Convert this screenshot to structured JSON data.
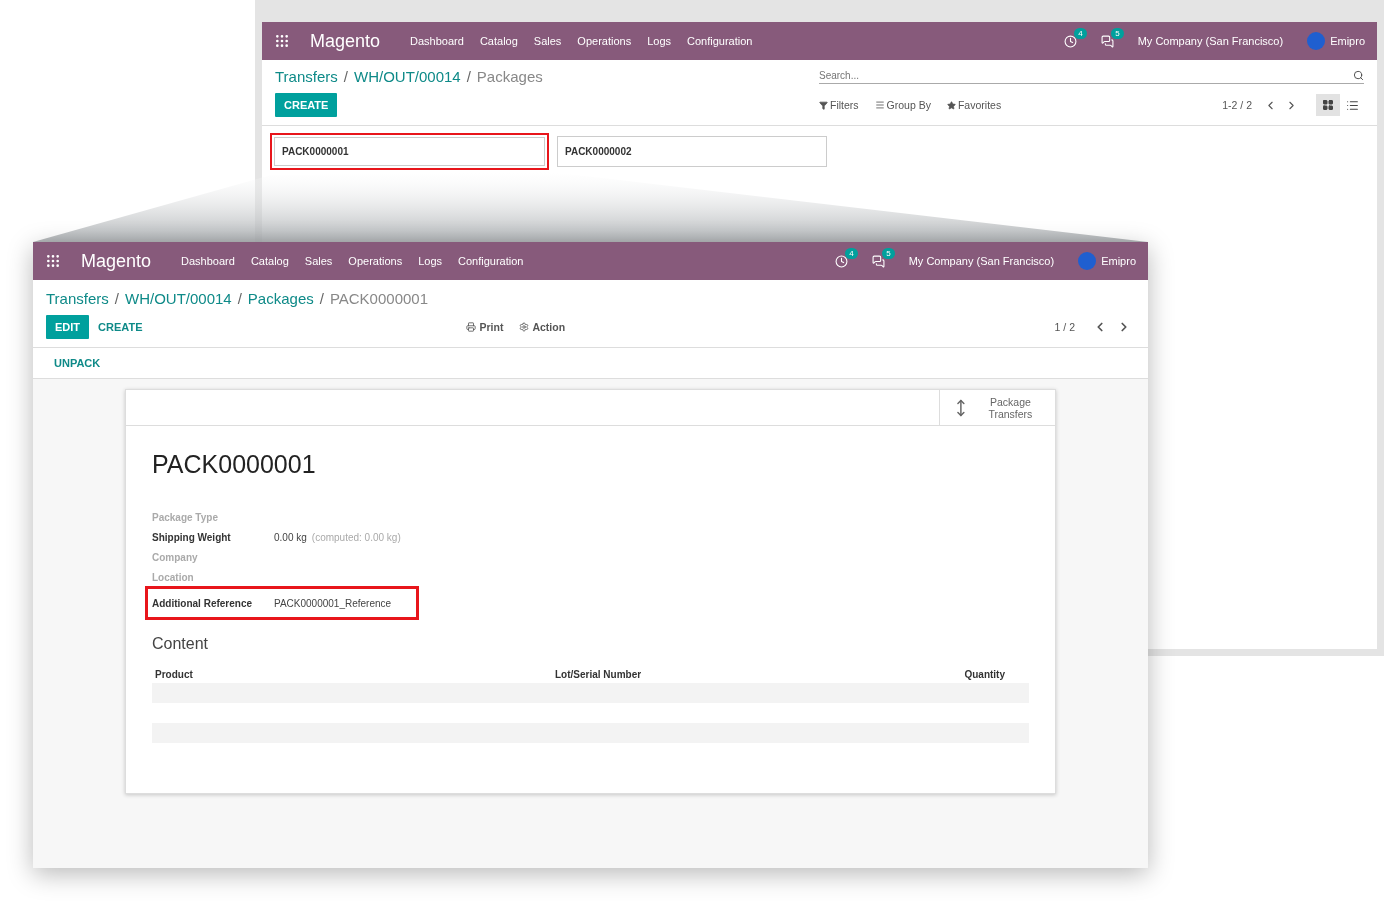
{
  "back_window": {
    "navbar": {
      "brand": "Magento",
      "menu": [
        "Dashboard",
        "Catalog",
        "Sales",
        "Operations",
        "Logs",
        "Configuration"
      ],
      "activity_count": "4",
      "message_count": "5",
      "company": "My Company (San Francisco)",
      "user": "Emipro"
    },
    "breadcrumbs": [
      {
        "label": "Transfers",
        "current": false
      },
      {
        "separator": "/",
        "label": "WH/OUT/00014",
        "current": false
      },
      {
        "separator": "/",
        "label": "Packages",
        "current": true
      }
    ],
    "create_button": "CREATE",
    "search": {
      "placeholder": "Search..."
    },
    "filters": [
      {
        "kind": "filter",
        "label": "Filters"
      },
      {
        "kind": "group",
        "label": "Group By"
      },
      {
        "kind": "favorite",
        "label": "Favorites"
      }
    ],
    "pager": "1-2 / 2",
    "views": [
      {
        "kind": "kanban",
        "selected": true
      },
      {
        "kind": "list",
        "selected": false
      }
    ],
    "cards": [
      {
        "name": "PACK0000001",
        "highlighted": true
      },
      {
        "name": "PACK0000002",
        "highlighted": false
      }
    ]
  },
  "front_window": {
    "navbar": {
      "brand": "Magento",
      "menu": [
        "Dashboard",
        "Catalog",
        "Sales",
        "Operations",
        "Logs",
        "Configuration"
      ],
      "activity_count": "4",
      "message_count": "5",
      "company": "My Company (San Francisco)",
      "user": "Emipro"
    },
    "breadcrumbs": [
      {
        "label": "Transfers",
        "current": false
      },
      {
        "separator": "/",
        "label": "WH/OUT/00014",
        "current": false
      },
      {
        "separator": "/",
        "label": "Packages",
        "current": false
      },
      {
        "separator": "/",
        "label": "PACK0000001",
        "current": true
      }
    ],
    "buttons": [
      {
        "label": "EDIT",
        "primary": true
      },
      {
        "label": "CREATE",
        "primary": false
      }
    ],
    "actions": [
      {
        "kind": "print",
        "label": "Print"
      },
      {
        "kind": "action",
        "label": "Action"
      }
    ],
    "pager": "1 / 2",
    "status_button": "UNPACK",
    "smart_button": {
      "label": "Package Transfers"
    },
    "title": "PACK0000001",
    "fields": [
      {
        "label": "Package Type",
        "muted": true,
        "highlighted": false
      },
      {
        "label": "Shipping Weight",
        "value": "0.00 kg",
        "note": "(computed: 0.00 kg)",
        "muted": false,
        "highlighted": false
      },
      {
        "label": "Company",
        "muted": true,
        "highlighted": false
      },
      {
        "label": "Location",
        "muted": true,
        "highlighted": false
      },
      {
        "label": "Additional Reference",
        "value": "PACK0000001_Reference",
        "muted": false,
        "highlighted": true
      }
    ],
    "section": "Content",
    "table": {
      "columns": [
        {
          "label": "Product",
          "kind": "text"
        },
        {
          "label": "Lot/Serial Number",
          "kind": "text"
        },
        {
          "label": "Quantity",
          "kind": "number"
        }
      ]
    }
  }
}
